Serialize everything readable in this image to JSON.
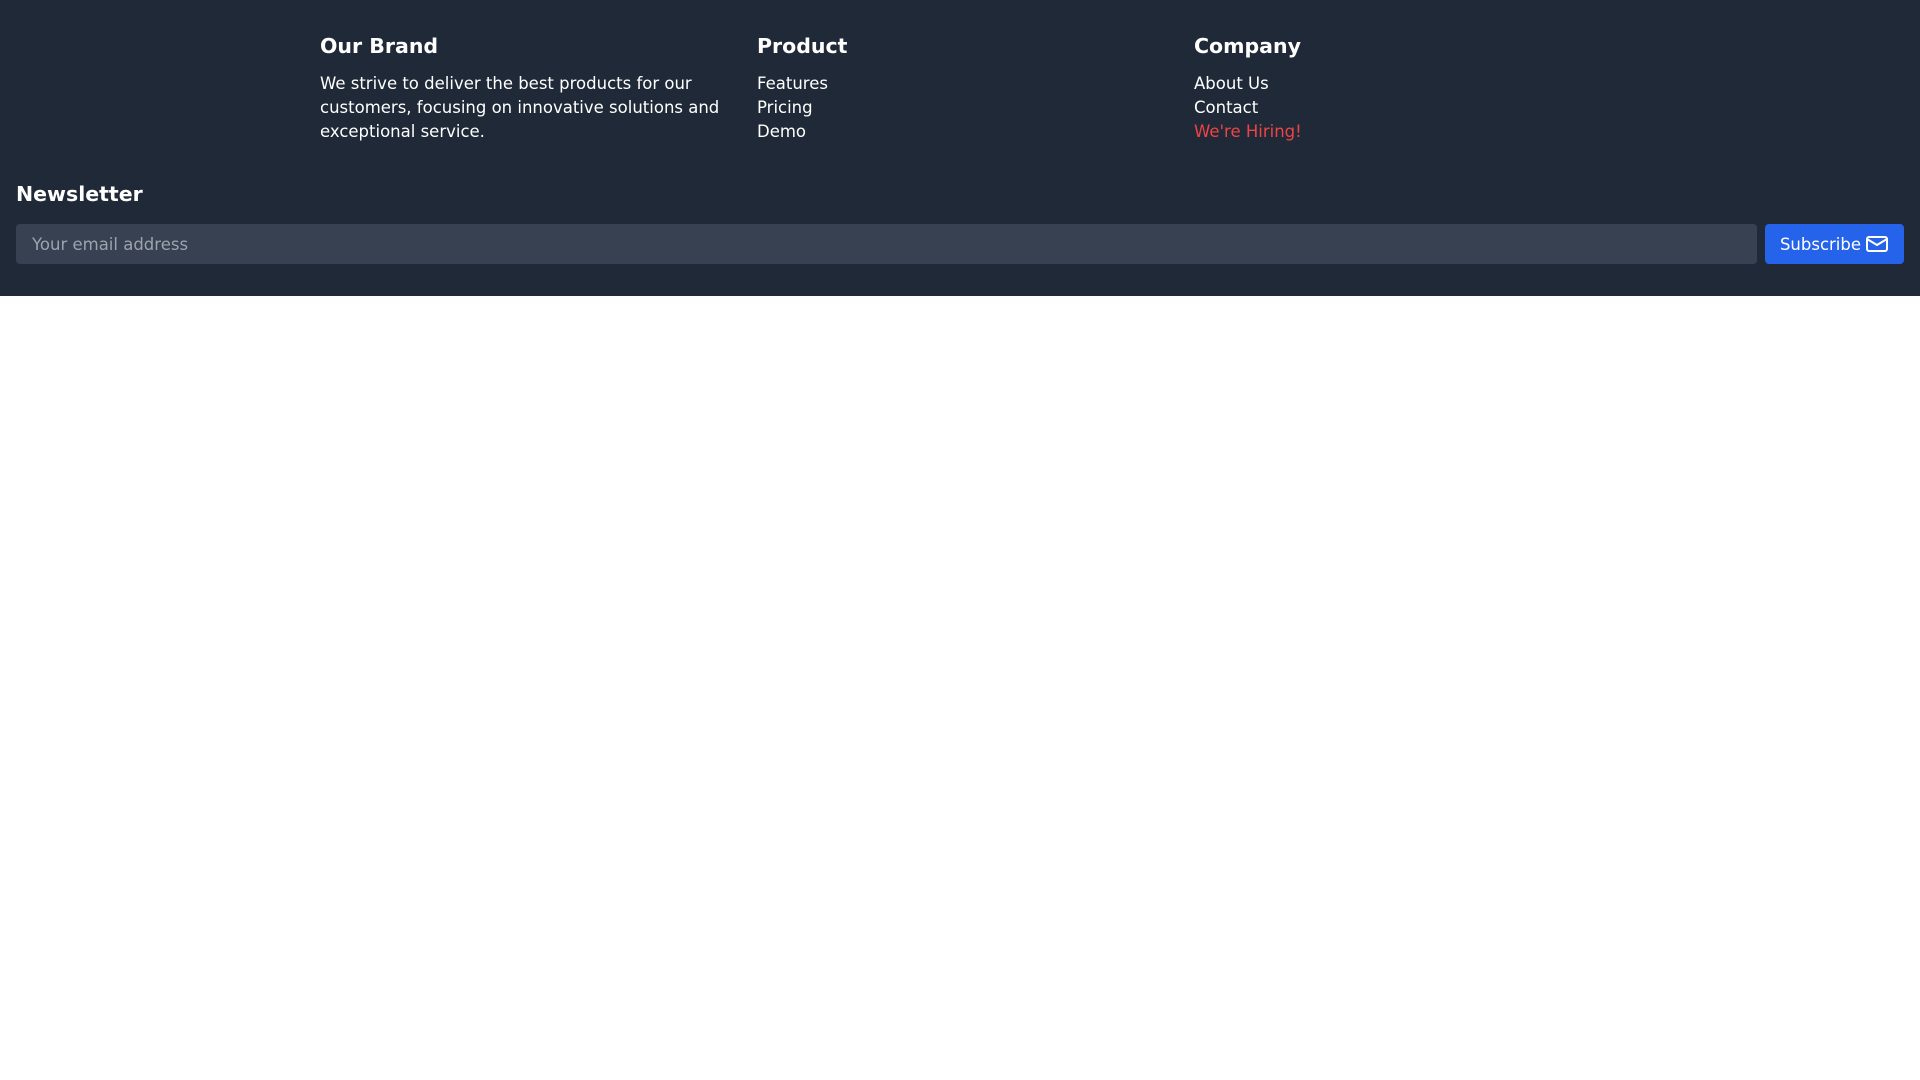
{
  "brand": {
    "title": "Our Brand",
    "description": "We strive to deliver the best products for our customers, focusing on innovative solutions and exceptional service."
  },
  "product": {
    "title": "Product",
    "links": [
      "Features",
      "Pricing",
      "Demo"
    ]
  },
  "company": {
    "title": "Company",
    "links": [
      "About Us",
      "Contact",
      "We're Hiring!"
    ]
  },
  "newsletter": {
    "title": "Newsletter",
    "email_placeholder": "Your email address",
    "subscribe_label": "Subscribe",
    "subscribe_icon": "mail-icon"
  },
  "colors": {
    "footer_bg": "#1f2937",
    "input_bg": "#374151",
    "accent": "#2563eb",
    "hiring": "#ef4444"
  }
}
